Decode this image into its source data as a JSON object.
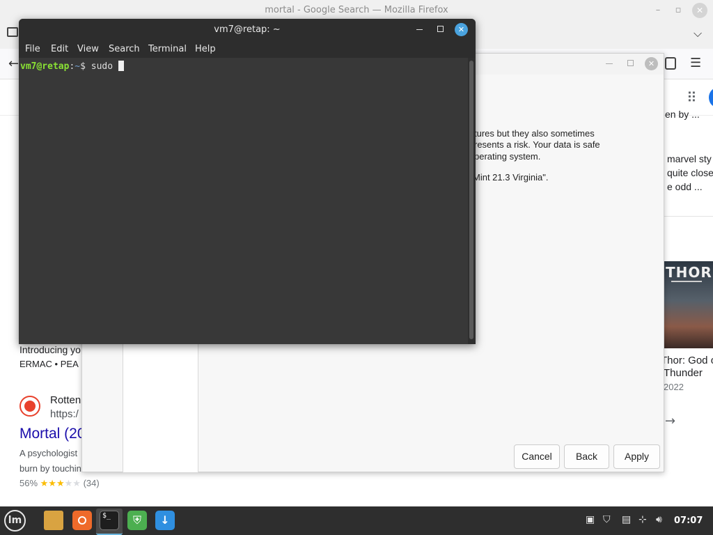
{
  "firefox": {
    "window_title": "mortal - Google Search — Mozilla Firefox",
    "minimize_glyph": "–",
    "maximize_glyph": "▫",
    "close_glyph": "✕"
  },
  "search_page": {
    "right_snippet_1": "en by ...",
    "right_snippet_2": "marvel sty",
    "right_snippet_3": "quite close t",
    "right_snippet_4": "e odd ...",
    "thor_poster_text": "THOR",
    "thor_caption_1": "Thor: God of",
    "thor_caption_2": "Thunder",
    "thor_year": "2022",
    "left_snippet_1": "Introducing yo",
    "left_snippet_2": "ERMAC • PEA",
    "result_source": "Rotten",
    "result_url": "https:/",
    "result_title": "Mortal (20",
    "result_desc_1": "A psychologist",
    "result_desc_2": "burn by touchin",
    "result_rating_pct": "56%",
    "result_stars": "★★★",
    "result_stars_empty": "★★",
    "result_rating_count": "(34)"
  },
  "dialog": {
    "line_1": "tures but they also sometimes",
    "line_2": "resents a risk. Your data is safe",
    "line_3": "perating system.",
    "line_4": "Mint 21.3 Virginia\".",
    "cancel_label": "Cancel",
    "back_label": "Back",
    "apply_label": "Apply"
  },
  "terminal": {
    "title": "vm7@retap: ~",
    "menu": [
      "File",
      "Edit",
      "View",
      "Search",
      "Terminal",
      "Help"
    ],
    "prompt_user": "vm7@retap",
    "prompt_sep": ":",
    "prompt_path": "~",
    "prompt_symbol": "$",
    "command": " sudo "
  },
  "taskbar": {
    "clock": "07:07",
    "apps": [
      "menu-icon",
      "files-icon",
      "firefox-icon",
      "terminal-icon",
      "shield-icon",
      "update-icon"
    ]
  }
}
